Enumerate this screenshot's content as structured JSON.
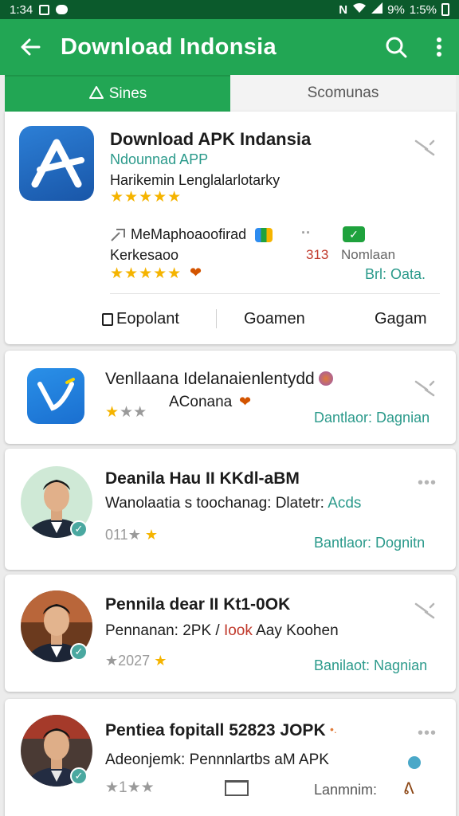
{
  "statusbar": {
    "time": "1:34",
    "right_text": "9%",
    "time_right": "1:5%"
  },
  "appbar": {
    "title": "Download Indonsia",
    "back_icon": "arrow-left-icon",
    "search_icon": "search-icon",
    "menu_icon": "more-vert-icon"
  },
  "tabs": [
    {
      "label": "Sines",
      "icon": "user-icon"
    },
    {
      "label": "Scomunas"
    }
  ],
  "featured": {
    "title": "Download APK Indansia",
    "subtitle": "Ndounnad APP",
    "meta": "Harikemin Lenglalarlotarky",
    "stars": "★★★★★",
    "detail1": "MeMaphoaoofirad",
    "detail2": "Kerkesaoo",
    "stars2": "★★★★★",
    "dot_text": "··",
    "count": "313",
    "status": "Nomlaan",
    "status2": "Brl: Oata.",
    "actions": [
      "Eopolant",
      "Goamen",
      "Gagam"
    ]
  },
  "items": [
    {
      "title": "Venllaana Idelanaienlentydd",
      "subtitle": "AConana",
      "stars": "★",
      "stars_gray": "★★",
      "action": "Dantlaor: Dagnian",
      "prefix": ""
    },
    {
      "title": "Deanila Hau II KKdl-aBM",
      "subtitle_prefix": "Wanolaatia s toochanag: Dlatetr:",
      "subtitle_accent": "Acds",
      "stars_prefix": "011",
      "stars_gray": "★",
      "stars": "★",
      "action": "Bantlaor: Dognitn"
    },
    {
      "title": "Pennila dear II Kt1-0OK",
      "subtitle_prefix": "Pennanan: 2PK / ",
      "subtitle_accent": "Iook",
      "subtitle_suffix": " Aay Koohen",
      "stars_prefix": "★2027",
      "stars": "★",
      "action": "Banilaot: Nagnian"
    },
    {
      "title": "Pentiea fopitall 52823 JOPK",
      "subtitle": "Adeonjemk: Pennnlartbs aM APK",
      "stars_gray": "★1★★",
      "action": "Lanmnim:"
    }
  ],
  "colors": {
    "primary": "#22a654",
    "statusbar": "#0b5a2c",
    "accent_teal": "#2b9a8b",
    "star": "#f5b400"
  }
}
